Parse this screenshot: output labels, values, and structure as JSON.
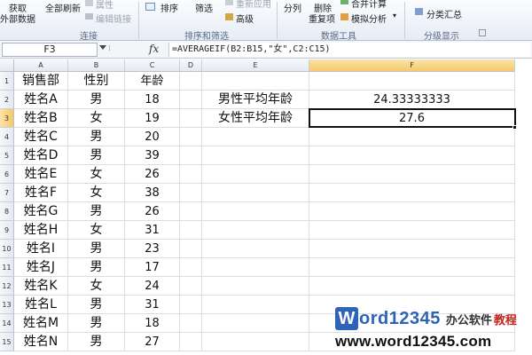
{
  "ribbon": {
    "get_external_data": [
      "获取",
      "外部数据"
    ],
    "refresh_all": [
      "全部刷新",
      ""
    ],
    "connections_small": [
      "属性",
      "编辑链接"
    ],
    "group_connections": "连接",
    "sort": "排序",
    "filter": "筛选",
    "reapply": "重新应用",
    "advanced": "高级",
    "group_sort_filter": "排序和筛选",
    "text_to_columns": "分列",
    "remove_duplicates": [
      "删除",
      "重复项"
    ],
    "consolidate": "合并计算",
    "what_if": "模拟分析",
    "group_data_tools": "数据工具",
    "subtotal": "分类汇总",
    "group_outline": "分级显示"
  },
  "formula_bar": {
    "name_box": "F3",
    "fx": "fx",
    "formula": "=AVERAGEIF(B2:B15,\"女\",C2:C15)"
  },
  "grid": {
    "columns": [
      "A",
      "B",
      "C",
      "D",
      "E",
      "F"
    ],
    "selected_column": "F",
    "selected_row": 3,
    "rows": [
      {
        "n": "1",
        "a": "销售部",
        "b": "性别",
        "c": "年龄",
        "e": "",
        "f": ""
      },
      {
        "n": "2",
        "a": "姓名A",
        "b": "男",
        "c": "18",
        "e": "男性平均年龄",
        "f": "24.33333333"
      },
      {
        "n": "3",
        "a": "姓名B",
        "b": "女",
        "c": "19",
        "e": "女性平均年龄",
        "f": "27.6"
      },
      {
        "n": "4",
        "a": "姓名C",
        "b": "男",
        "c": "20",
        "e": "",
        "f": ""
      },
      {
        "n": "5",
        "a": "姓名D",
        "b": "男",
        "c": "39",
        "e": "",
        "f": ""
      },
      {
        "n": "6",
        "a": "姓名E",
        "b": "女",
        "c": "26",
        "e": "",
        "f": ""
      },
      {
        "n": "7",
        "a": "姓名F",
        "b": "女",
        "c": "38",
        "e": "",
        "f": ""
      },
      {
        "n": "8",
        "a": "姓名G",
        "b": "男",
        "c": "26",
        "e": "",
        "f": ""
      },
      {
        "n": "9",
        "a": "姓名H",
        "b": "女",
        "c": "31",
        "e": "",
        "f": ""
      },
      {
        "n": "10",
        "a": "姓名I",
        "b": "男",
        "c": "23",
        "e": "",
        "f": ""
      },
      {
        "n": "11",
        "a": "姓名J",
        "b": "男",
        "c": "17",
        "e": "",
        "f": ""
      },
      {
        "n": "12",
        "a": "姓名K",
        "b": "女",
        "c": "24",
        "e": "",
        "f": ""
      },
      {
        "n": "13",
        "a": "姓名L",
        "b": "男",
        "c": "31",
        "e": "",
        "f": ""
      },
      {
        "n": "14",
        "a": "姓名M",
        "b": "男",
        "c": "18",
        "e": "",
        "f": ""
      },
      {
        "n": "15",
        "a": "姓名N",
        "b": "男",
        "c": "27",
        "e": "",
        "f": ""
      }
    ]
  },
  "watermark": {
    "logo_w": "W",
    "logo_rest": "ord12345",
    "tag": "办公软件",
    "tag2": "教程",
    "url": "www.word12345.com"
  },
  "colors": {
    "selection_header": "#f5c96a",
    "watermark_blue": "#2e63b8",
    "watermark_red": "#c0261c"
  }
}
